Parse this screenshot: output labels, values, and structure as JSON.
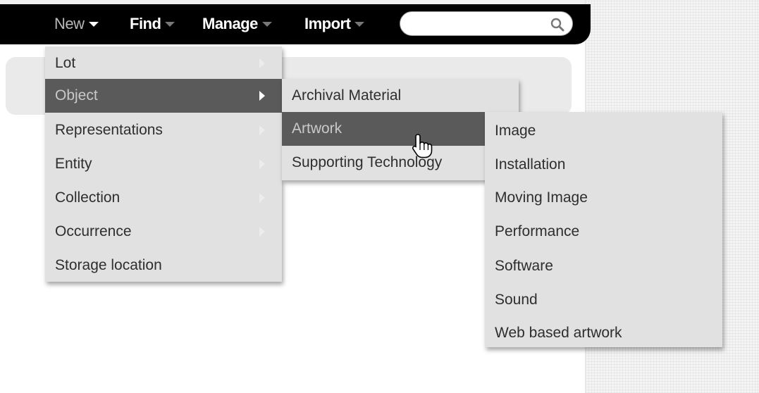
{
  "nav": {
    "items": [
      {
        "label": "New",
        "state": "active"
      },
      {
        "label": "Find",
        "state": "normal"
      },
      {
        "label": "Manage",
        "state": "normal"
      },
      {
        "label": "Import",
        "state": "normal"
      }
    ],
    "search": {
      "value": "",
      "placeholder": "",
      "icon": "search-icon"
    }
  },
  "menus": {
    "level1": [
      {
        "label": "Lot",
        "submenu": true
      },
      {
        "label": "Object",
        "submenu": true,
        "selected": true
      },
      {
        "label": "Representations",
        "submenu": true
      },
      {
        "label": "Entity",
        "submenu": true
      },
      {
        "label": "Collection",
        "submenu": true
      },
      {
        "label": "Occurrence",
        "submenu": true
      },
      {
        "label": "Storage location",
        "submenu": false
      }
    ],
    "level2": [
      {
        "label": "Archival Material"
      },
      {
        "label": "Artwork",
        "selected": true
      },
      {
        "label": "Supporting Technology"
      }
    ],
    "level3": [
      {
        "label": "Image"
      },
      {
        "label": "Installation"
      },
      {
        "label": "Moving Image"
      },
      {
        "label": "Performance"
      },
      {
        "label": "Software"
      },
      {
        "label": "Sound"
      },
      {
        "label": "Web based artwork"
      }
    ]
  },
  "colors": {
    "navbar": "#000000",
    "menu_bg": "#e1e1e1",
    "menu_selected": "#5a5a5a"
  },
  "cursor": "hand-pointer-icon"
}
